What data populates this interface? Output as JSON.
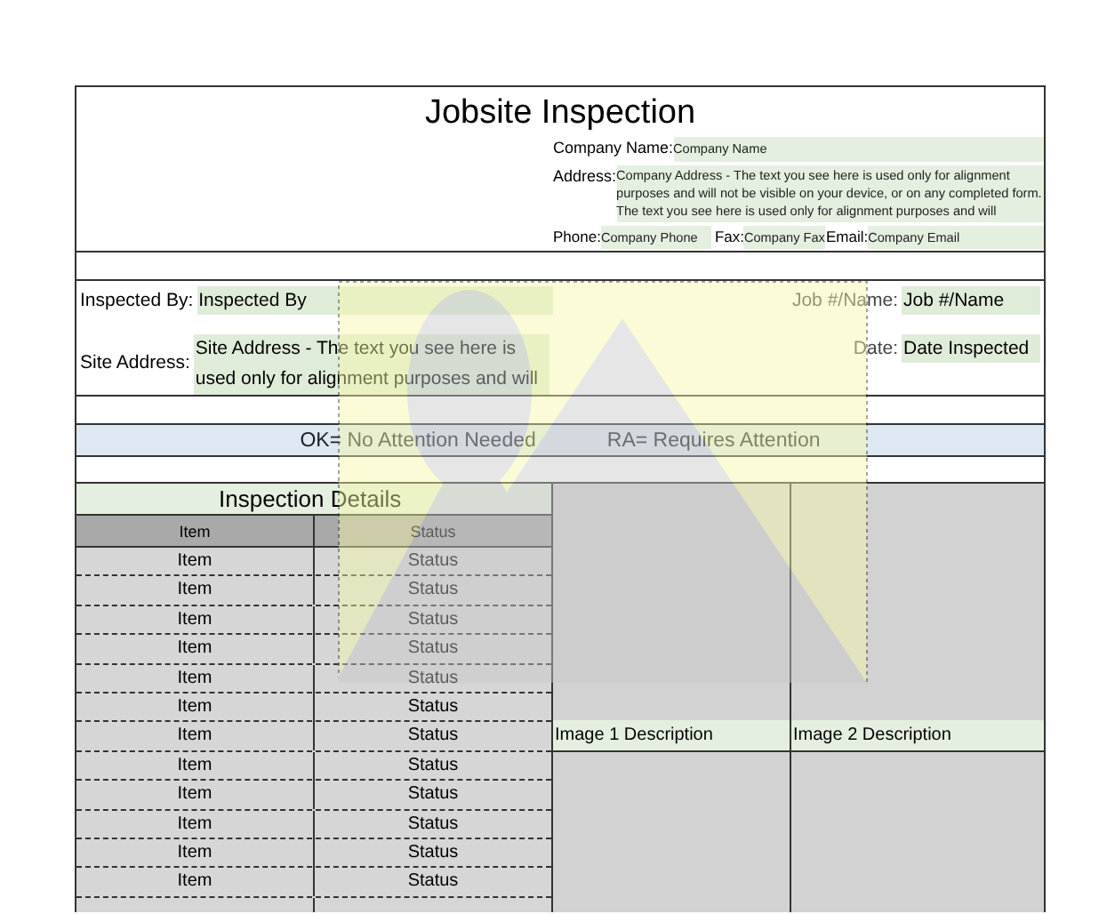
{
  "title": "Jobsite Inspection",
  "company_fields": [
    {
      "label": "Company Name:",
      "value": "Company Name"
    },
    {
      "label": "Address:",
      "value": "Company Address - The text you see here is used only for alignment purposes and will not be visible on your device, or on any completed form. The text you see here is used only for alignment purposes and will"
    }
  ],
  "contact_fields": [
    {
      "label": "Phone:",
      "value": "Company Phone"
    },
    {
      "label": "Fax:",
      "value": "Company Fax"
    },
    {
      "label": "Email:",
      "value": "Company Email"
    }
  ],
  "inspection_fields": [
    {
      "label": "Inspected By:",
      "value": "Inspected By"
    },
    {
      "label": "Job #/Name:",
      "value": "Job #/Name"
    },
    {
      "label": "Site Address:",
      "value": "Site Address - The text you see here is used only for alignment purposes and will"
    },
    {
      "label": "Date:",
      "value": "Date Inspected"
    }
  ],
  "legend": [
    "OK= No Attention Needed",
    "RA= Requires Attention"
  ],
  "details": {
    "title": "Inspection Details",
    "columns": [
      "Item",
      "Status"
    ],
    "rows": [
      {
        "item": "Item",
        "status": "Status"
      },
      {
        "item": "Item",
        "status": "Status"
      },
      {
        "item": "Item",
        "status": "Status"
      },
      {
        "item": "Item",
        "status": "Status"
      },
      {
        "item": "Item",
        "status": "Status"
      },
      {
        "item": "Item",
        "status": "Status"
      },
      {
        "item": "Item",
        "status": "Status"
      },
      {
        "item": "Item",
        "status": "Status"
      },
      {
        "item": "Item",
        "status": "Status"
      },
      {
        "item": "Item",
        "status": "Status"
      },
      {
        "item": "Item",
        "status": "Status"
      },
      {
        "item": "Item",
        "status": "Status"
      }
    ]
  },
  "image_descriptions": [
    "Image 1 Description",
    "Image 2 Description"
  ]
}
